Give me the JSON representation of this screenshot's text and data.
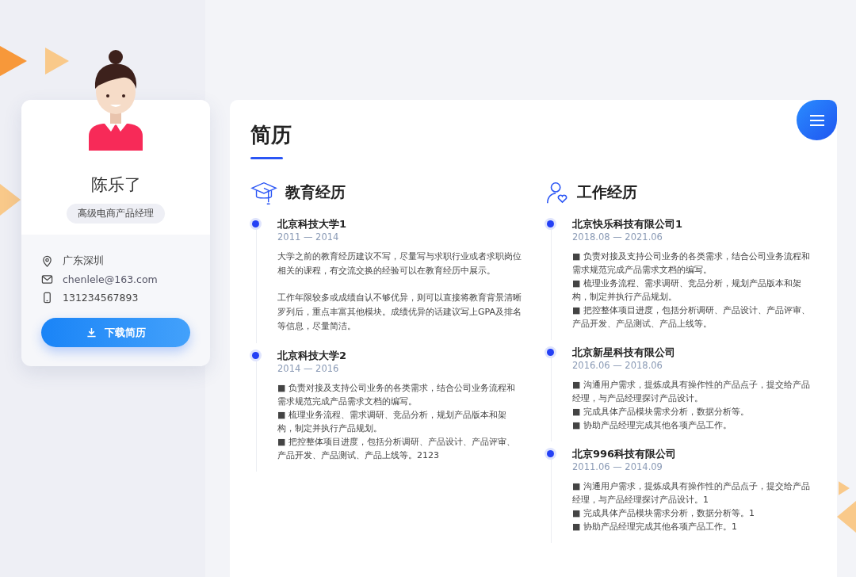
{
  "profile": {
    "name": "陈乐了",
    "title": "高级电商产品经理",
    "contacts": [
      {
        "kind": "location",
        "text": "广东深圳"
      },
      {
        "kind": "email",
        "text": "chenlele@163.com"
      },
      {
        "kind": "phone",
        "text": "131234567893"
      }
    ],
    "download_button": "下载简历"
  },
  "resume": {
    "heading": "简历",
    "sections": [
      {
        "kind": "education",
        "title": "教育经历",
        "entries": [
          {
            "name": "北京科技大学1",
            "period": "2011 — 2014",
            "paragraphs": [
              "大学之前的教育经历建议不写，尽量写与求职行业或者求职岗位相关的课程，有交流交换的经验可以在教育经历中展示。",
              "工作年限较多或成绩自认不够优异，则可以直接将教育背景清晰罗列后，重点丰富其他模块。成绩优异的话建议写上GPA及排名等信息，尽量简洁。"
            ]
          },
          {
            "name": "北京科技大学2",
            "period": "2014 — 2016",
            "lines": [
              "■ 负责对接及支持公司业务的各类需求，结合公司业务流程和需求规范完成产品需求文档的编写。",
              "■ 梳理业务流程、需求调研、竞品分析，规划产品版本和架构，制定并执行产品规划。",
              "■ 把控整体项目进度，包括分析调研、产品设计、产品评审、产品开发、产品测试、产品上线等。2123"
            ]
          }
        ]
      },
      {
        "kind": "work",
        "title": "工作经历",
        "entries": [
          {
            "name": "北京快乐科技有限公司1",
            "period": "2018.08 — 2021.06",
            "lines": [
              "■ 负责对接及支持公司业务的各类需求，结合公司业务流程和需求规范完成产品需求文档的编写。",
              "■ 梳理业务流程、需求调研、竞品分析，规划产品版本和架构，制定并执行产品规划。",
              "■ 把控整体项目进度，包括分析调研、产品设计、产品评审、产品开发、产品测试、产品上线等。"
            ]
          },
          {
            "name": "北京新星科技有限公司",
            "period": "2016.06 — 2018.06",
            "lines": [
              "■ 沟通用户需求，提炼成具有操作性的产品点子，提交给产品经理，与产品经理探讨产品设计。",
              "■ 完成具体产品模块需求分析，数据分析等。",
              "■ 协助产品经理完成其他各项产品工作。"
            ]
          },
          {
            "name": "北京996科技有限公司",
            "period": "2011.06 — 2014.09",
            "lines": [
              "■ 沟通用户需求，提炼成具有操作性的产品点子，提交给产品经理，与产品经理探讨产品设计。1",
              "■ 完成具体产品模块需求分析，数据分析等。1",
              "■ 协助产品经理完成其他各项产品工作。1"
            ]
          }
        ]
      }
    ]
  }
}
